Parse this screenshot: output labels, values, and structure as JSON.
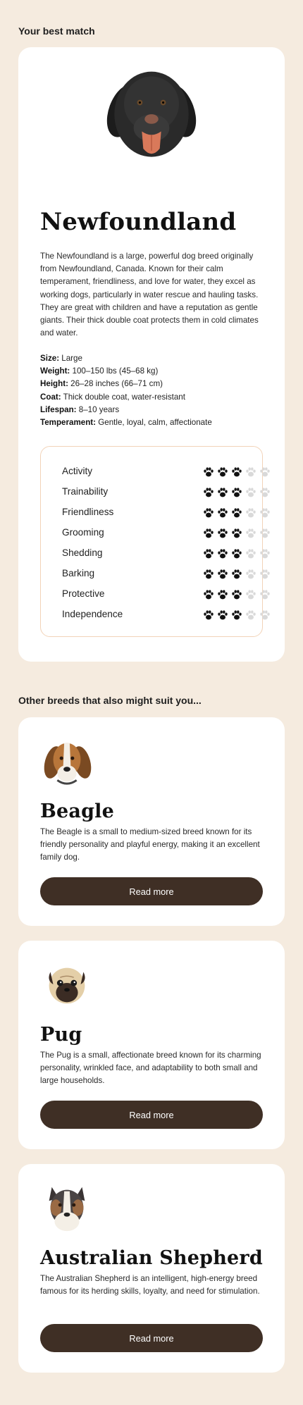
{
  "best": {
    "section_title": "Your best match",
    "name": "Newfoundland",
    "description": "The Newfoundland is a large, powerful dog breed originally from Newfoundland, Canada. Known for their calm temperament, friendliness, and love for water, they excel as working dogs, particularly in water rescue and hauling tasks. They are great with children and have a reputation as gentle giants. Their thick double coat protects them in cold climates and water.",
    "facts": [
      {
        "label": "Size:",
        "value": " Large"
      },
      {
        "label": "Weight:",
        "value": " 100–150 lbs (45–68 kg)"
      },
      {
        "label": "Height:",
        "value": " 26–28 inches (66–71 cm)"
      },
      {
        "label": "Coat:",
        "value": " Thick double coat, water-resistant"
      },
      {
        "label": "Lifespan:",
        "value": " 8–10 years"
      },
      {
        "label": "Temperament:",
        "value": " Gentle, loyal, calm, affectionate"
      }
    ],
    "traits": [
      {
        "label": "Activity",
        "rating": 3,
        "max": 5
      },
      {
        "label": "Trainability",
        "rating": 3,
        "max": 5
      },
      {
        "label": "Friendliness",
        "rating": 3,
        "max": 5
      },
      {
        "label": "Grooming",
        "rating": 3,
        "max": 5
      },
      {
        "label": "Shedding",
        "rating": 3,
        "max": 5
      },
      {
        "label": "Barking",
        "rating": 3,
        "max": 5
      },
      {
        "label": "Protective",
        "rating": 3,
        "max": 5
      },
      {
        "label": "Independence",
        "rating": 3,
        "max": 5
      }
    ],
    "icon": "newfoundland-portrait"
  },
  "others": {
    "section_title": "Other breeds that also might suit you...",
    "breeds": [
      {
        "name": "Beagle",
        "description": "The Beagle is a small to medium-sized breed known for its friendly personality and playful energy, making it an excellent family dog.",
        "button": "Read more",
        "icon": "beagle-portrait"
      },
      {
        "name": "Pug",
        "description": "The Pug is a small, affectionate breed known for its charming personality, wrinkled face, and adaptability to both small and large households.",
        "button": "Read more",
        "icon": "pug-portrait"
      },
      {
        "name": "Australian Shepherd",
        "description": "The Australian Shepherd is an intelligent, high-energy breed famous for its herding skills, loyalty, and need for stimulation.",
        "button": "Read more",
        "icon": "australian-shepherd-portrait"
      }
    ]
  },
  "colors": {
    "background": "#f5ebdf",
    "card": "#ffffff",
    "button": "#3f2f25",
    "paw_filled": "#111111",
    "paw_empty": "#d9d9d9",
    "traits_border": "#f2d3b8"
  }
}
